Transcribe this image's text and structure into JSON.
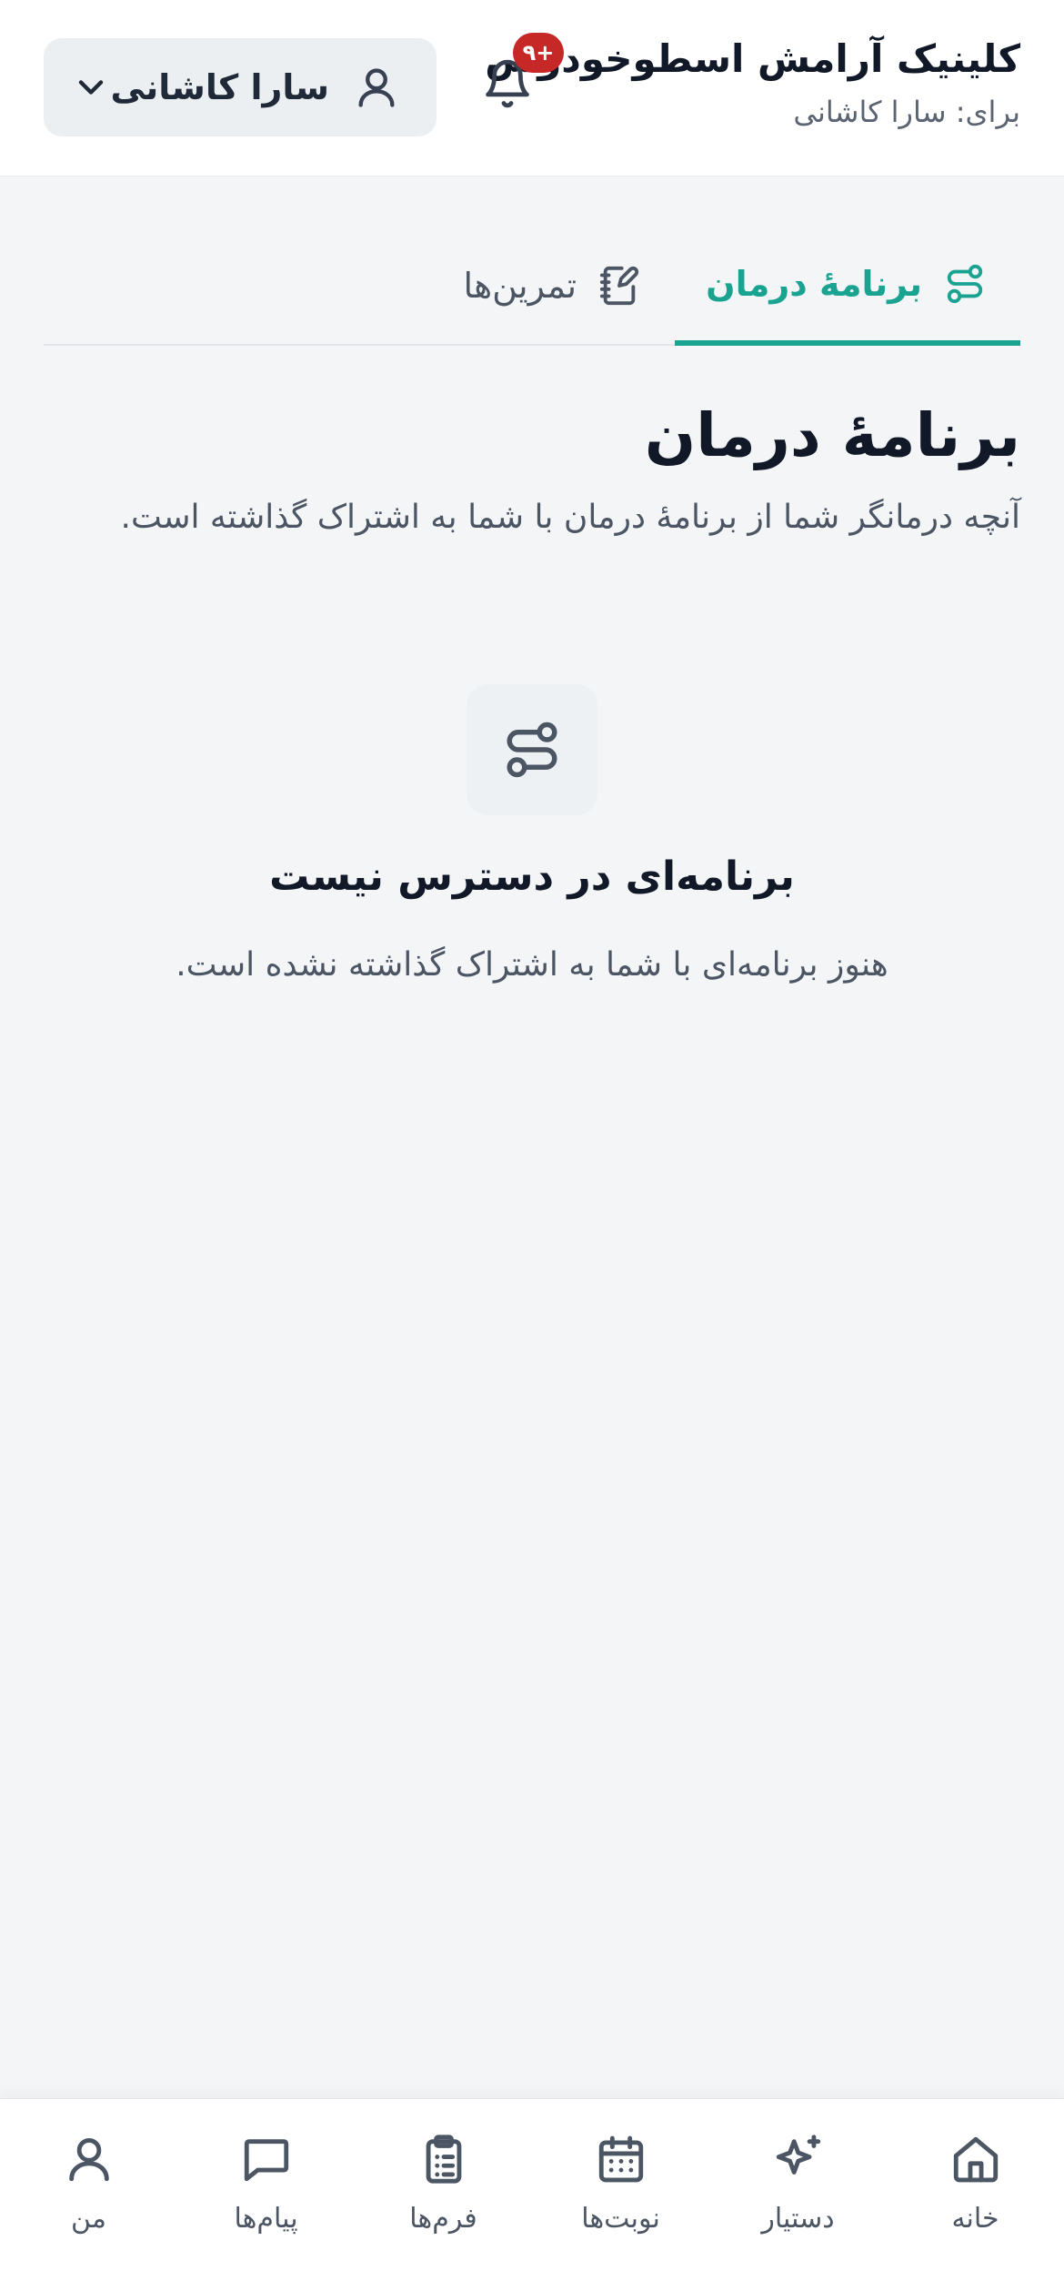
{
  "header": {
    "clinic_name": "کلینیک آرامش اسطوخودوس",
    "for_label": "برای: سارا کاشانی",
    "notifications_badge": "۹+",
    "user_selector": {
      "name": "سارا کاشانی"
    }
  },
  "tabs": [
    {
      "label": "برنامهٔ درمان",
      "icon": "route-icon",
      "active": true
    },
    {
      "label": "تمرین‌ها",
      "icon": "notebook-pen-icon",
      "active": false
    }
  ],
  "main": {
    "title": "برنامهٔ درمان",
    "subtitle": "آنچه درمانگر شما از برنامهٔ درمان با شما به اشتراک گذاشته است.",
    "empty_state": {
      "icon": "route-icon",
      "title": "برنامه‌ای در دسترس نیست",
      "text": "هنوز برنامه‌ای با شما به اشتراک گذاشته نشده است."
    }
  },
  "bottom_nav": [
    {
      "label": "خانه",
      "icon": "home-icon"
    },
    {
      "label": "دستیار",
      "icon": "sparkles-icon"
    },
    {
      "label": "نوبت‌ها",
      "icon": "calendar-icon"
    },
    {
      "label": "فرم‌ها",
      "icon": "clipboard-icon"
    },
    {
      "label": "پیام‌ها",
      "icon": "message-icon"
    },
    {
      "label": "من",
      "icon": "user-icon"
    }
  ],
  "colors": {
    "accent": "#1aa391",
    "badge": "#c62828",
    "background": "#f3f5f7",
    "text_primary": "#111827",
    "text_secondary": "#4b5563"
  }
}
